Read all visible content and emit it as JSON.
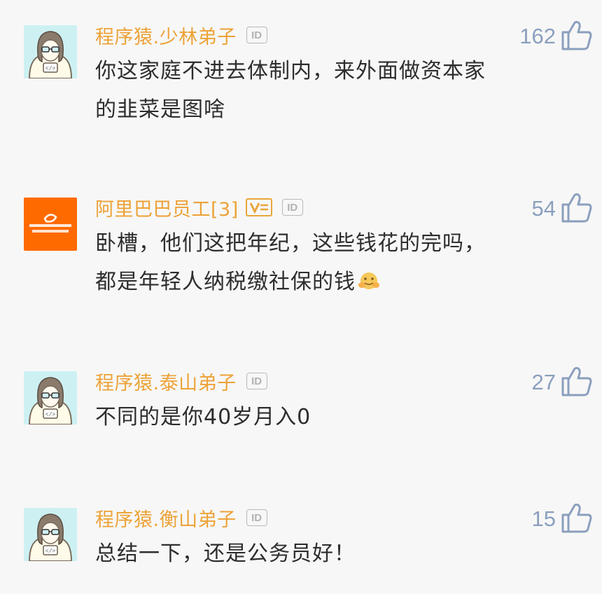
{
  "comments": [
    {
      "username": "程序猿.少林弟子",
      "id_badge": "ID",
      "text": "你这家庭不进去体制内，来外面做资本家的韭菜是图啥",
      "likes": "162",
      "avatar_icon": "programmer-avatar-icon"
    },
    {
      "username": "阿里巴巴员工[3]",
      "id_badge": "ID",
      "verified_badge": "V",
      "text": "卧槽，他们这把年纪，这些钱花的完吗，都是年轻人纳税缴社保的钱",
      "emoji": "hug-emoji-icon",
      "likes": "54",
      "avatar_icon": "alibaba-logo-avatar-icon"
    },
    {
      "username": "程序猿.泰山弟子",
      "id_badge": "ID",
      "text": "不同的是你40岁月入0",
      "likes": "27",
      "avatar_icon": "programmer-avatar-icon"
    },
    {
      "username": "程序猿.衡山弟子",
      "id_badge": "ID",
      "text": "总结一下，还是公务员好！",
      "likes": "15",
      "avatar_icon": "programmer-avatar-icon"
    }
  ],
  "colors": {
    "username": "#eda237",
    "like": "#8b9fbe",
    "text": "#2d2d2d",
    "background": "#f7f7f7",
    "alibaba": "#ff6a00"
  }
}
